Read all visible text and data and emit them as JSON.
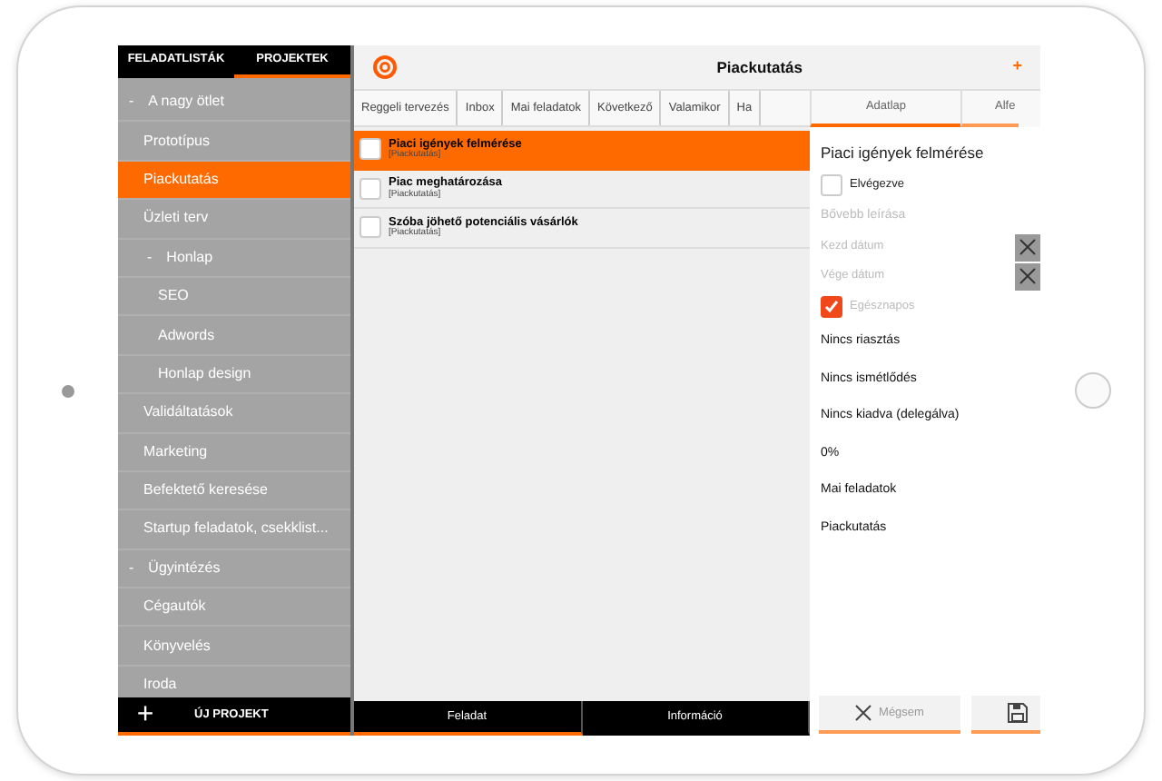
{
  "sidebar": {
    "tabs": [
      {
        "label": "FELADATLISTÁK",
        "selected": false
      },
      {
        "label": "PROJEKTEK",
        "selected": true
      }
    ],
    "items": [
      {
        "label": "A nagy ötlet",
        "toggle": "-",
        "selected": false,
        "children": [
          {
            "label": "Prototípus",
            "selected": false
          },
          {
            "label": "Piackutatás",
            "selected": true
          },
          {
            "label": "Üzleti terv",
            "selected": false
          },
          {
            "label": "Honlap",
            "toggle": "-",
            "selected": false,
            "children": [
              {
                "label": "SEO",
                "selected": false
              },
              {
                "label": "Adwords",
                "selected": false
              },
              {
                "label": "Honlap design",
                "selected": false
              }
            ]
          },
          {
            "label": "Validáltatások",
            "selected": false
          },
          {
            "label": "Marketing",
            "selected": false
          },
          {
            "label": "Befektető keresése",
            "selected": false
          },
          {
            "label": "Startup feladatok, csekklist...",
            "selected": false
          }
        ]
      },
      {
        "label": "Ügyintézés",
        "toggle": "-",
        "selected": false,
        "children": [
          {
            "label": "Cégautók",
            "selected": false
          },
          {
            "label": "Könyvelés",
            "selected": false
          },
          {
            "label": "Iroda",
            "selected": false
          }
        ]
      }
    ],
    "footer": {
      "plus": "+",
      "label": "ÚJ PROJEKT"
    }
  },
  "header": {
    "title": "Piackutatás",
    "action": "+"
  },
  "list_tabs": [
    {
      "label": "Reggeli tervezés"
    },
    {
      "label": "Inbox"
    },
    {
      "label": "Mai feladatok"
    },
    {
      "label": "Következő"
    },
    {
      "label": "Valamikor"
    },
    {
      "label": "Ha"
    }
  ],
  "tasks": [
    {
      "title": "Piaci igények felmérése",
      "project": "[Piackutatás]",
      "selected": true,
      "checked": false
    },
    {
      "title": "Piac meghatározása",
      "project": "[Piackutatás]",
      "selected": false,
      "checked": false
    },
    {
      "title": "Szóba jöhető potenciális vásárlók",
      "project": "[Piackutatás]",
      "selected": false,
      "checked": false
    }
  ],
  "bottom_tabs": [
    {
      "label": "Feladat",
      "selected": true
    },
    {
      "label": "Információ",
      "selected": false
    }
  ],
  "detail": {
    "tabs": [
      {
        "label": "Adatlap",
        "selected": true
      },
      {
        "label": "Alfe",
        "selected": false
      }
    ],
    "title": "Piaci igények felmérése",
    "fields": [
      {
        "kind": "checkbox",
        "label": "Elvégezve",
        "checked": false,
        "muted": false
      },
      {
        "kind": "hint",
        "label": "Bővebb leírása"
      },
      {
        "kind": "date",
        "label": "Kezd dátum"
      },
      {
        "kind": "date",
        "label": "Vége dátum"
      },
      {
        "kind": "checkbox",
        "label": "Egésznapos",
        "checked": true,
        "muted": true
      },
      {
        "kind": "value",
        "label": "Nincs riasztás"
      },
      {
        "kind": "value",
        "label": "Nincs ismétlődés"
      },
      {
        "kind": "value",
        "label": "Nincs kiadva (delegálva)"
      },
      {
        "kind": "value",
        "label": "0%"
      },
      {
        "kind": "value",
        "label": "Mai feladatok"
      },
      {
        "kind": "value",
        "label": "Piackutatás"
      }
    ],
    "cancel": "Mégsem"
  }
}
